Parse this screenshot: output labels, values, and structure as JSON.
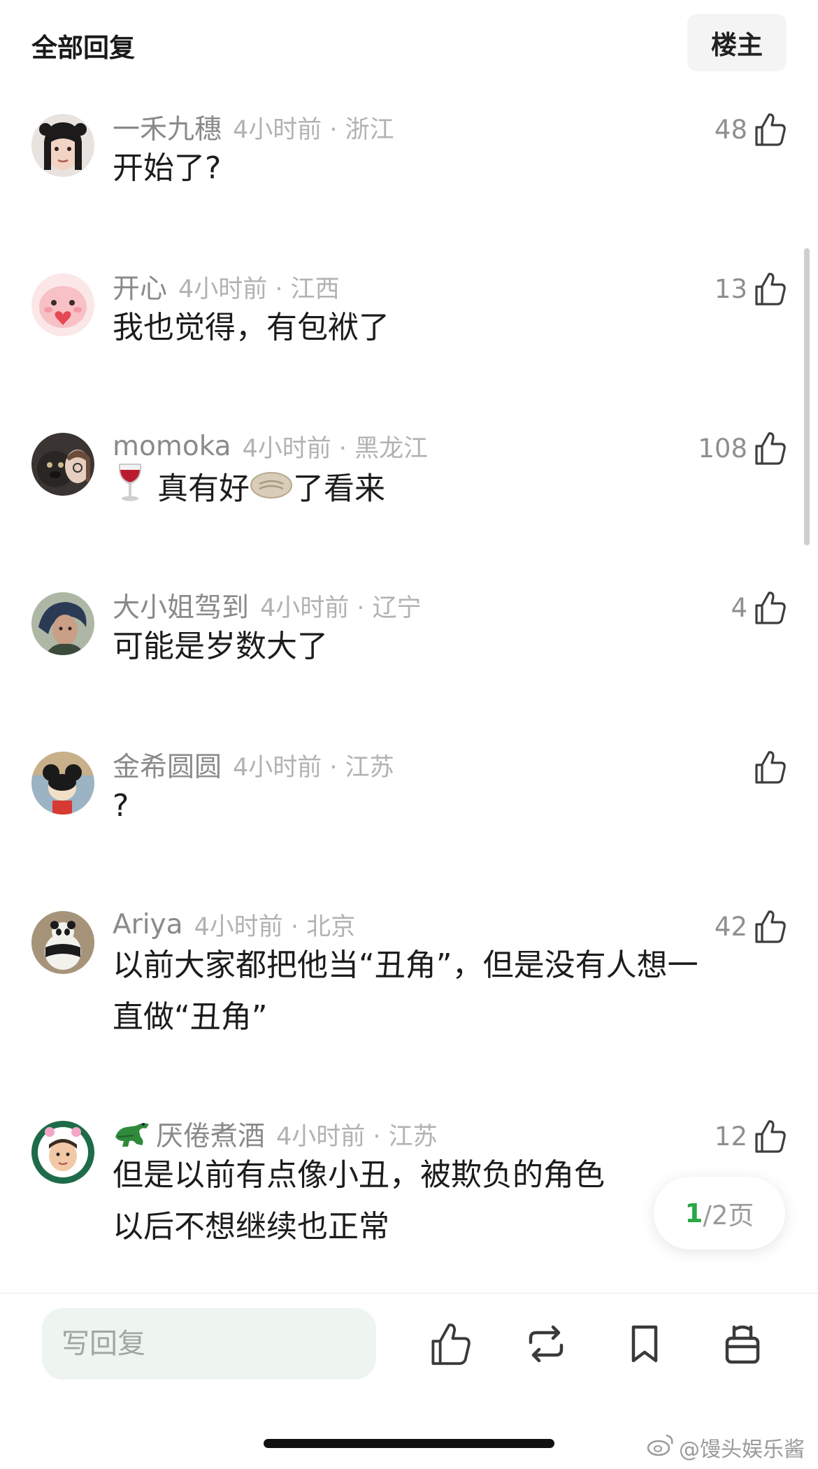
{
  "header": {
    "title": "全部回复",
    "owner_button": "楼主"
  },
  "comments": [
    {
      "username": "一禾九穗",
      "time_location": "4小时前 · 浙江",
      "likes": "48",
      "text": "开始了?"
    },
    {
      "username": "开心",
      "time_location": "4小时前 · 江西",
      "likes": "13",
      "text": "我也觉得，有包袱了"
    },
    {
      "username": "momoka",
      "time_location": "4小时前 · 黑龙江",
      "likes": "108",
      "text_a": "真有好",
      "text_b": "了看来"
    },
    {
      "username": "大小姐驾到",
      "time_location": "4小时前 · 辽宁",
      "likes": "4",
      "text": "可能是岁数大了"
    },
    {
      "username": "金希圆圆",
      "time_location": "4小时前 · 江苏",
      "likes": "",
      "text": "?"
    },
    {
      "username": "Ariya",
      "time_location": "4小时前 · 北京",
      "likes": "42",
      "text_line1": "以前大家都把他当“丑角”，但是没有人想一",
      "text_line2": "直做“丑角”"
    },
    {
      "username": "厌倦煮酒",
      "time_location": "4小时前 · 江苏",
      "likes": "12",
      "text_line1": "但是以前有点像小丑，被欺负的角色",
      "text_line2": "以后不想继续也正常"
    }
  ],
  "pager": {
    "current": "1",
    "total_text": "/2页"
  },
  "bottom_bar": {
    "reply_placeholder": "写回复"
  },
  "watermark": "@馒头娱乐酱",
  "colors": {
    "accent_green": "#2aa745",
    "muted_text": "#8a8a8a"
  },
  "icons": [
    "thumbs-up-icon",
    "repost-icon",
    "bookmark-icon",
    "gift-icon",
    "weibo-logo-icon",
    "wine-glass-icon",
    "flatbread-icon",
    "crocodile-icon"
  ]
}
